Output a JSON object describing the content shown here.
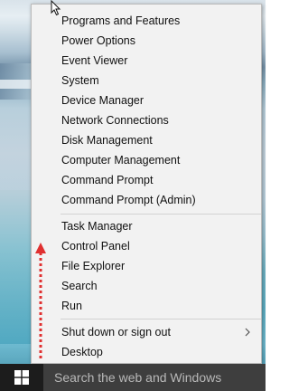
{
  "menu": {
    "items": [
      {
        "label": "Programs and Features"
      },
      {
        "label": "Power Options"
      },
      {
        "label": "Event Viewer"
      },
      {
        "label": "System"
      },
      {
        "label": "Device Manager"
      },
      {
        "label": "Network Connections"
      },
      {
        "label": "Disk Management"
      },
      {
        "label": "Computer Management"
      },
      {
        "label": "Command Prompt"
      },
      {
        "label": "Command Prompt (Admin)"
      },
      {
        "label": "Task Manager"
      },
      {
        "label": "Control Panel"
      },
      {
        "label": "File Explorer"
      },
      {
        "label": "Search"
      },
      {
        "label": "Run"
      },
      {
        "label": "Shut down or sign out",
        "submenu": true
      },
      {
        "label": "Desktop"
      }
    ]
  },
  "taskbar": {
    "search_placeholder": "Search the web and Windows"
  },
  "annotations": {
    "arrow_color": "#e03030"
  },
  "icons": {
    "start": "windows-logo-icon",
    "submenu": "chevron-right-icon",
    "cursor": "mouse-cursor-icon"
  }
}
